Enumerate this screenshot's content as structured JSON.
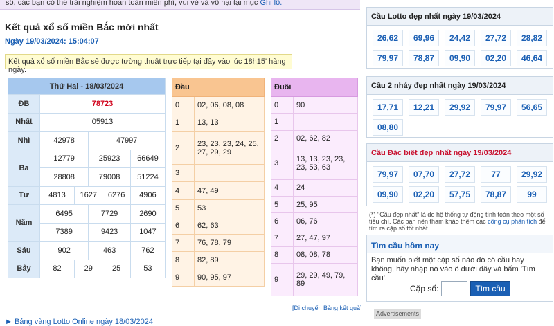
{
  "top_notice": {
    "text": "số, các bạn có thể trải nghiệm hoàn toàn miễn phí, vui vẻ và vô hại tại mục ",
    "link": "Ghi lô."
  },
  "title": "Kết quả xổ số miền Bắc mới nhất",
  "date": "Ngày 19/03/2024: 15:04:07",
  "notice": "Kết quả xổ số miền Bắc sẽ được tường thuật trực tiếp tại đây vào lúc 18h15' hàng ngày.",
  "results": {
    "header": "Thứ Hai - 18/03/2024",
    "rows": [
      {
        "label": "ĐB",
        "values": [
          "78723"
        ]
      },
      {
        "label": "Nhất",
        "values": [
          "05913"
        ]
      },
      {
        "label": "Nhì",
        "values": [
          "42978",
          "47997"
        ]
      },
      {
        "label": "Ba",
        "values": [
          "12779",
          "25923",
          "66649",
          "28808",
          "79008",
          "51224"
        ]
      },
      {
        "label": "Tư",
        "values": [
          "4813",
          "1627",
          "6276",
          "4906"
        ]
      },
      {
        "label": "Năm",
        "values": [
          "6495",
          "7729",
          "2690",
          "7389",
          "9423",
          "1047"
        ]
      },
      {
        "label": "Sáu",
        "values": [
          "902",
          "463",
          "762"
        ]
      },
      {
        "label": "Bảy",
        "values": [
          "82",
          "29",
          "25",
          "53"
        ]
      }
    ]
  },
  "dau": {
    "header": "Đầu",
    "rows": [
      {
        "n": "0",
        "v": "02, 06, 08, 08"
      },
      {
        "n": "1",
        "v": "13, 13"
      },
      {
        "n": "2",
        "v": "23, 23, 23, 24, 25, 27, 29, 29"
      },
      {
        "n": "3",
        "v": ""
      },
      {
        "n": "4",
        "v": "47, 49"
      },
      {
        "n": "5",
        "v": "53"
      },
      {
        "n": "6",
        "v": "62, 63"
      },
      {
        "n": "7",
        "v": "76, 78, 79"
      },
      {
        "n": "8",
        "v": "82, 89"
      },
      {
        "n": "9",
        "v": "90, 95, 97"
      }
    ]
  },
  "duoi": {
    "header": "Đuôi",
    "rows": [
      {
        "n": "0",
        "v": "90"
      },
      {
        "n": "1",
        "v": ""
      },
      {
        "n": "2",
        "v": "02, 62, 82"
      },
      {
        "n": "3",
        "v": "13, 13, 23, 23, 23, 53, 63"
      },
      {
        "n": "4",
        "v": "24"
      },
      {
        "n": "5",
        "v": "25, 95"
      },
      {
        "n": "6",
        "v": "06, 76"
      },
      {
        "n": "7",
        "v": "27, 47, 97"
      },
      {
        "n": "8",
        "v": "08, 08, 78"
      },
      {
        "n": "9",
        "v": "29, 29, 49, 79, 89"
      }
    ]
  },
  "move_link": "[Di chuyển Bảng kết quả]",
  "bottom_link": "Bảng vàng Lotto Online ngày 18/03/2024",
  "panels": [
    {
      "title": "Cầu Lotto đẹp nhất ngày 19/03/2024",
      "red": false,
      "numbers": [
        "26,62",
        "69,96",
        "24,42",
        "27,72",
        "28,82",
        "79,97",
        "78,87",
        "09,90",
        "02,20",
        "46,64"
      ]
    },
    {
      "title": "Cầu 2 nháy đẹp nhất ngày 19/03/2024",
      "red": false,
      "numbers": [
        "17,71",
        "12,21",
        "29,92",
        "79,97",
        "56,65",
        "08,80"
      ]
    },
    {
      "title": "Cầu Đặc biệt đẹp nhất ngày 19/03/2024",
      "red": true,
      "numbers": [
        "79,97",
        "07,70",
        "27,72",
        "77",
        "29,92",
        "09,90",
        "02,20",
        "57,75",
        "78,87",
        "99"
      ]
    }
  ],
  "note": {
    "text": "(*) \"Cầu đẹp nhất\" là do hệ thống tự động tính toán theo một số tiêu chí. Các bạn nên tham khảo thêm các ",
    "link": "công cụ phân tích",
    "tail": " để tìm ra cặp số tốt nhất."
  },
  "find": {
    "title": "Tìm cầu hôm nay",
    "desc": "Bạn muốn biết một cặp số nào đó có cầu hay không, hãy nhập nó vào ô dưới đây và bấm 'Tìm cầu'.",
    "label": "Cặp số:",
    "button": "Tìm cầu"
  },
  "ads": "Advertisements",
  "colors": {
    "accent": "#1a5fb4",
    "special": "#d0021b"
  }
}
